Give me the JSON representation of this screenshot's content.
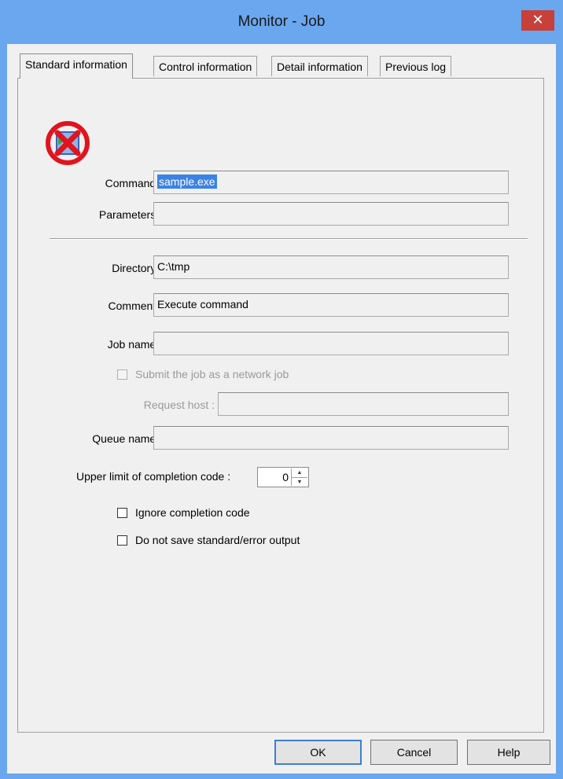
{
  "window": {
    "title": "Monitor - Job",
    "close_glyph": "✕"
  },
  "tabs": [
    {
      "label": "Standard information",
      "active": true
    },
    {
      "label": "Control information",
      "active": false
    },
    {
      "label": "Detail information",
      "active": false
    },
    {
      "label": "Previous log",
      "active": false
    }
  ],
  "status_icon": "error-x-icon",
  "form": {
    "command_label": "Command :",
    "command_value": "sample.exe",
    "parameters_label": "Parameters :",
    "parameters_value": "",
    "directory_label": "Directory :",
    "directory_value": "C:\\tmp",
    "comment_label": "Comment :",
    "comment_value": "Execute command",
    "job_name_label": "Job name :",
    "job_name_value": "",
    "network_job_label": "Submit the job as a network job",
    "network_job_checked": false,
    "request_host_label": "Request host :",
    "request_host_value": "",
    "queue_name_label": "Queue name :",
    "queue_name_value": "",
    "upper_limit_label": "Upper limit of completion code :",
    "upper_limit_value": "0",
    "ignore_code_label": "Ignore completion code",
    "ignore_code_checked": false,
    "no_save_output_label": "Do not save standard/error output",
    "no_save_output_checked": false
  },
  "buttons": {
    "ok": "OK",
    "cancel": "Cancel",
    "help": "Help"
  },
  "colors": {
    "titlebar": "#6aa7ef",
    "close": "#c7403a",
    "selection": "#3b82e6",
    "error_icon": "#e0141e"
  }
}
